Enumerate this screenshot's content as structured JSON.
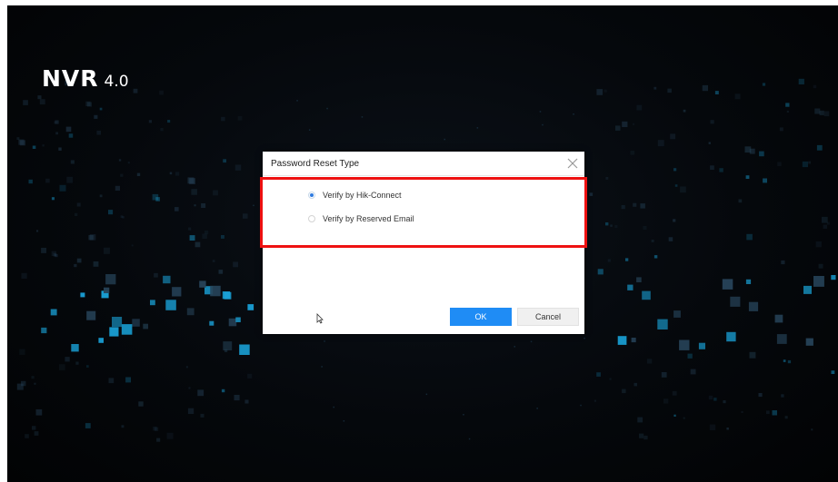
{
  "logo": {
    "name": "NVR",
    "version": "4.0"
  },
  "dialog": {
    "title": "Password Reset Type",
    "options": [
      {
        "label": "Verify by Hik-Connect",
        "selected": true
      },
      {
        "label": "Verify by Reserved Email",
        "selected": false
      }
    ],
    "ok_label": "OK",
    "cancel_label": "Cancel"
  },
  "colors": {
    "primary_button": "#1f8cf5",
    "highlight_border": "#ee1111",
    "background": "#05080c",
    "particle": "#1aa3d9"
  },
  "icons": {
    "close": "close-icon",
    "cursor": "mouse-pointer-icon"
  }
}
